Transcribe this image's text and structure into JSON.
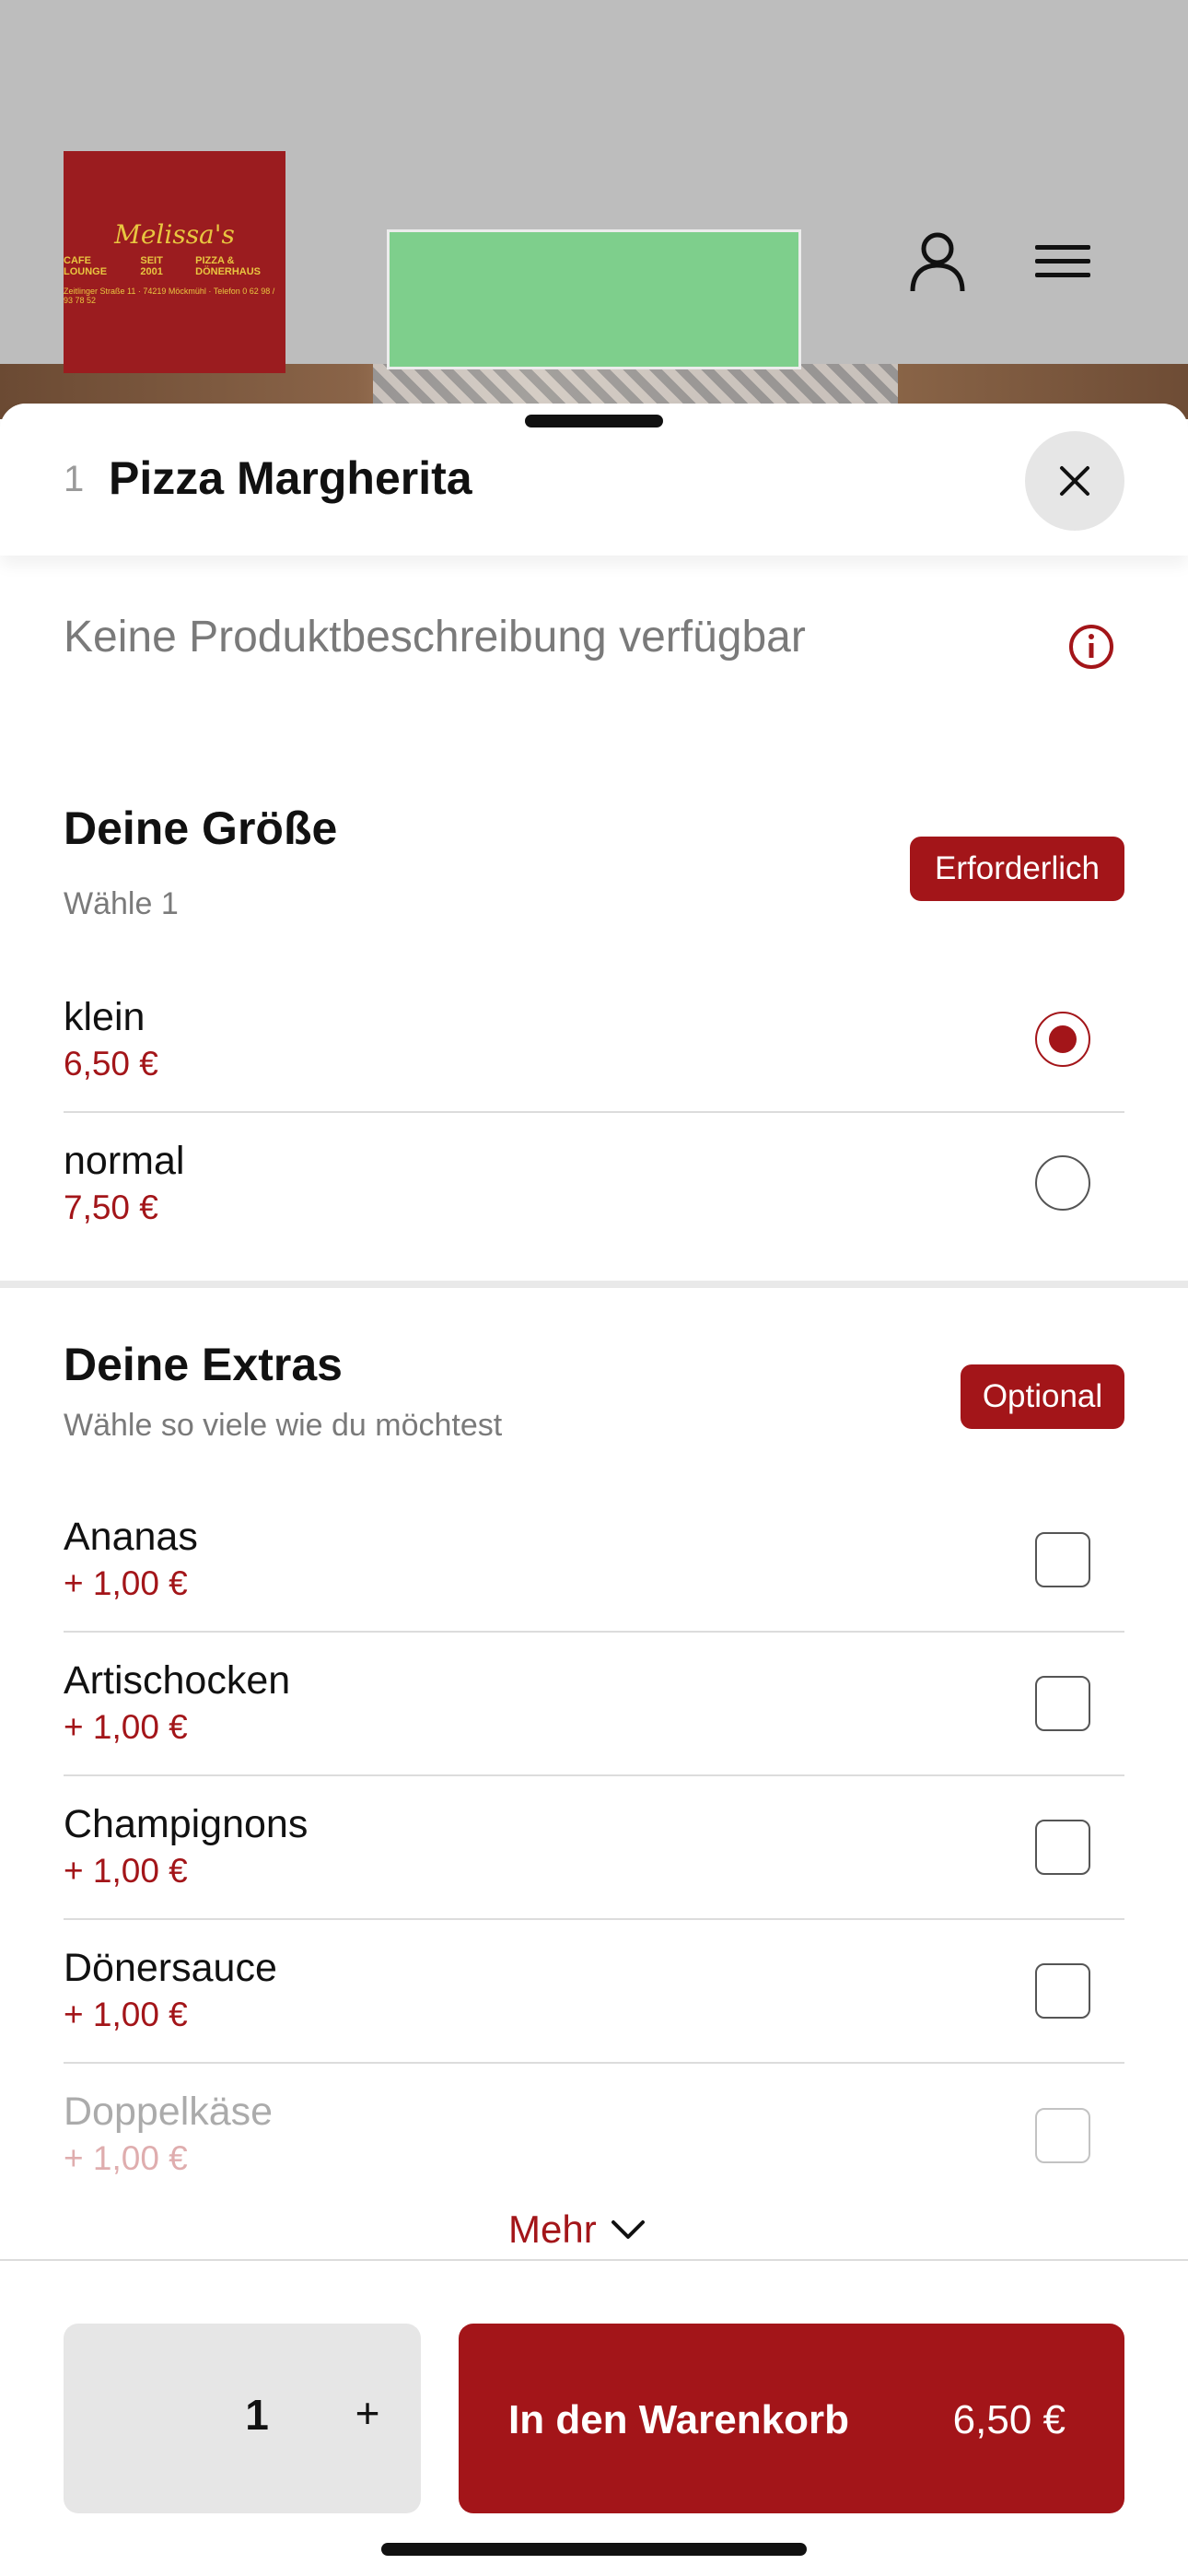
{
  "header": {
    "logo": {
      "name": "Melissa's",
      "left_text": "CAFE LOUNGE",
      "mid_text": "SEIT 2001",
      "right_text": "PIZZA & DÖNERHAUS",
      "address": "Zeitlinger Straße 11 · 74219 Möckmühl · Telefon 0 62 98 / 93 78 52"
    },
    "icons": {
      "account": "user-icon",
      "menu": "hamburger-menu-icon"
    }
  },
  "product": {
    "index": "1",
    "title": "Pizza Margherita",
    "description": "Keine Produktbeschreibung verfügbar"
  },
  "size_group": {
    "title": "Deine Größe",
    "subtitle": "Wähle 1",
    "badge": "Erforderlich",
    "options": [
      {
        "name": "klein",
        "price": "6,50 €",
        "selected": true
      },
      {
        "name": "normal",
        "price": "7,50 €",
        "selected": false
      }
    ]
  },
  "extras_group": {
    "title": "Deine Extras",
    "subtitle": "Wähle so viele wie du möchtest",
    "badge": "Optional",
    "options": [
      {
        "name": "Ananas",
        "price": "+ 1,00 €",
        "checked": false
      },
      {
        "name": "Artischocken",
        "price": "+ 1,00 €",
        "checked": false
      },
      {
        "name": "Champignons",
        "price": "+ 1,00 €",
        "checked": false
      },
      {
        "name": "Dönersauce",
        "price": "+ 1,00 €",
        "checked": false
      },
      {
        "name": "Doppelkäse",
        "price": "+ 1,00 €",
        "checked": false
      }
    ],
    "more_label": "Mehr"
  },
  "footer": {
    "quantity": "1",
    "plus_label": "+",
    "add_to_cart_label": "In den Warenkorb",
    "total": "6,50 €"
  },
  "colors": {
    "accent": "#a31519",
    "banner": "#7ecf8c",
    "header_bg": "#bdbdbd"
  }
}
